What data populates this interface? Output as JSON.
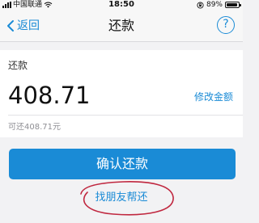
{
  "status_bar": {
    "carrier": "中国联通",
    "time": "18:50",
    "battery_text": "89%",
    "battery_level": 0.89,
    "icons": [
      "signal-icon",
      "wifi-icon",
      "orientation-lock-icon",
      "battery-icon"
    ]
  },
  "nav": {
    "back_label": "返回",
    "title": "还款",
    "help_label": "?"
  },
  "repay": {
    "label": "还款",
    "amount": "408.71",
    "edit_label": "修改金额",
    "available_text": "可还408.71元"
  },
  "confirm_label": "确认还款",
  "friend_help_label": "找朋友帮还",
  "colors": {
    "accent": "#1a8bd6",
    "annotation": "#c0273f",
    "background": "#f2f2f4"
  }
}
